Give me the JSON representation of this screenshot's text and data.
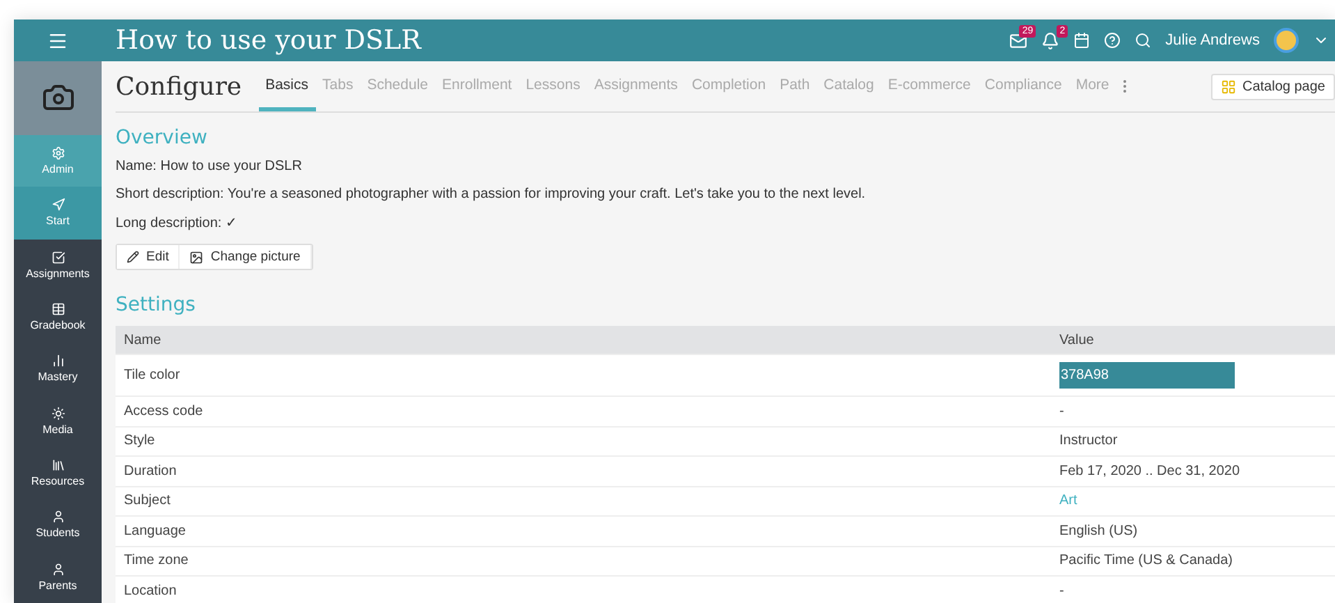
{
  "header": {
    "title": "How to use your DSLR",
    "badges": [
      {
        "kind": "mail",
        "count": "29"
      },
      {
        "kind": "bell",
        "count": "2"
      }
    ],
    "user": "Julie Andrews"
  },
  "sidebar": {
    "items": [
      {
        "label": "Admin",
        "kind": "admin",
        "selected": false
      },
      {
        "label": "Start",
        "kind": "start",
        "selected": true
      },
      {
        "label": "Assignments",
        "kind": "assignments",
        "selected": false
      },
      {
        "label": "Gradebook",
        "kind": "gradebook",
        "selected": false
      },
      {
        "label": "Mastery",
        "kind": "mastery",
        "selected": false
      },
      {
        "label": "Media",
        "kind": "media",
        "selected": false
      },
      {
        "label": "Resources",
        "kind": "resources",
        "selected": false
      },
      {
        "label": "Students",
        "kind": "students",
        "selected": false
      },
      {
        "label": "Parents",
        "kind": "parents",
        "selected": false
      }
    ]
  },
  "page": {
    "title": "Configure",
    "tabs": [
      {
        "label": "Basics",
        "selected": true
      },
      {
        "label": "Tabs",
        "selected": false
      },
      {
        "label": "Schedule",
        "selected": false
      },
      {
        "label": "Enrollment",
        "selected": false
      },
      {
        "label": "Lessons",
        "selected": false
      },
      {
        "label": "Assignments",
        "selected": false
      },
      {
        "label": "Completion",
        "selected": false
      },
      {
        "label": "Path",
        "selected": false
      },
      {
        "label": "Catalog",
        "selected": false
      },
      {
        "label": "E-commerce",
        "selected": false
      },
      {
        "label": "Compliance",
        "selected": false
      },
      {
        "label": "More",
        "selected": false
      }
    ],
    "catalog_button": "Catalog page"
  },
  "overview": {
    "heading": "Overview",
    "lines": [
      "Name: How to use your DSLR",
      "Short description: You're a seasoned photographer with a passion for improving your craft. Let's take you to the next level.",
      "Long description: ✓"
    ],
    "buttons": [
      {
        "kind": "edit",
        "label": "Edit"
      },
      {
        "kind": "picture",
        "label": "Change picture"
      }
    ]
  },
  "settings": {
    "heading": "Settings",
    "columns": [
      "Name",
      "Value"
    ],
    "rows": [
      {
        "name": "Tile color",
        "value": "378A98",
        "kind": "color",
        "color": "#378a98"
      },
      {
        "name": "Access code",
        "value": "-",
        "kind": "text"
      },
      {
        "name": "Style",
        "value": "Instructor",
        "kind": "text"
      },
      {
        "name": "Duration",
        "value": "Feb 17, 2020 .. Dec 31, 2020",
        "kind": "text"
      },
      {
        "name": "Subject",
        "value": "Art",
        "kind": "link"
      },
      {
        "name": "Language",
        "value": "English (US)",
        "kind": "text"
      },
      {
        "name": "Time zone",
        "value": "Pacific Time (US & Canada)",
        "kind": "text"
      },
      {
        "name": "Location",
        "value": "-",
        "kind": "text"
      }
    ]
  }
}
